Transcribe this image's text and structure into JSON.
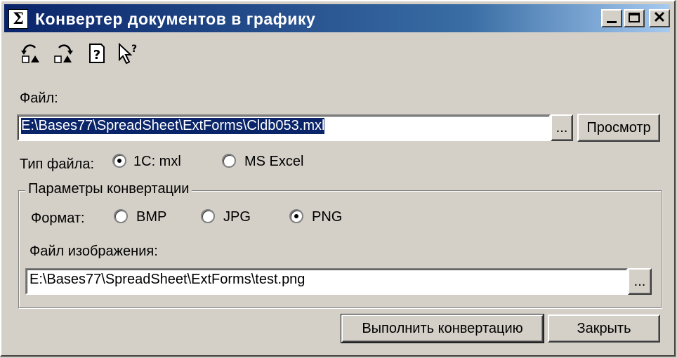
{
  "window": {
    "title": "Конвертер документов в графику",
    "app_icon_glyph": "Σ",
    "controls": {
      "minimize": "minimize",
      "maximize": "maximize",
      "close": "✕"
    }
  },
  "toolbar": {
    "icons": [
      "undo-icon",
      "redo-icon",
      "help-icon",
      "whats-this-icon"
    ]
  },
  "file": {
    "label": "Файл:",
    "value": "E:\\Bases77\\SpreadSheet\\ExtForms\\Cldb053.mxl",
    "browse_label": "...",
    "preview_label": "Просмотр"
  },
  "file_type": {
    "label": "Тип файла:",
    "options": [
      "1С: mxl",
      "MS Excel"
    ],
    "selected": "1С: mxl"
  },
  "conversion": {
    "group_title": "Параметры конвертации",
    "format_label": "Формат:",
    "formats": [
      "BMP",
      "JPG",
      "PNG"
    ],
    "selected_format": "PNG",
    "image_file_label": "Файл изображения:",
    "image_file_value": "E:\\Bases77\\SpreadSheet\\ExtForms\\test.png",
    "browse_label": "..."
  },
  "actions": {
    "convert_label": "Выполнить конвертацию",
    "close_label": "Закрыть"
  }
}
